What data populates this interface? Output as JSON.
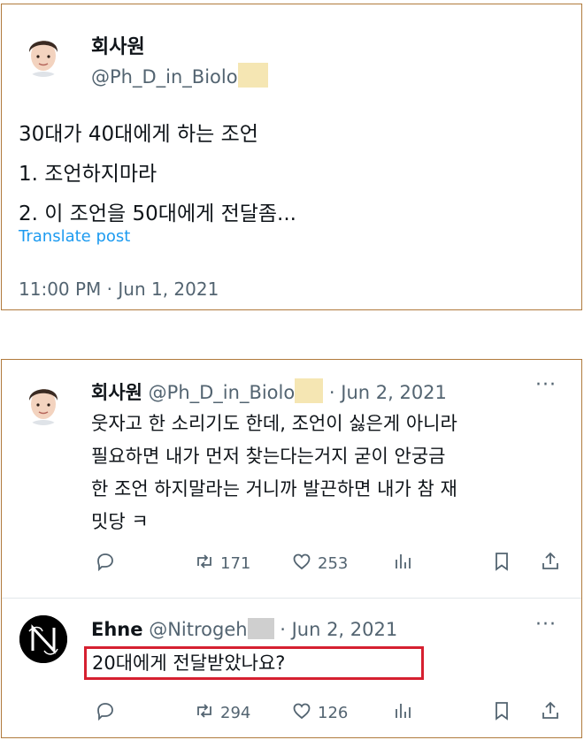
{
  "post": {
    "author_name": "회사원",
    "author_handle": "@Ph_D_in_Biolo",
    "lines": [
      "30대가 40대에게 하는 조언",
      "1. 조언하지마라",
      "2. 이 조언을 50대에게 전달좀..."
    ],
    "translate": "Translate post",
    "timestamp": "11:00 PM · Jun 1, 2021"
  },
  "reply1": {
    "author_name": "회사원",
    "author_handle": "@Ph_D_in_Biolo",
    "date": "· Jun 2, 2021",
    "more": "···",
    "lines": [
      "웃자고 한 소리기도 한데, 조언이 싫은게 아니라",
      "필요하면 내가 먼저 찾는다는거지 굳이 안궁금",
      "한 조언 하지말라는 거니까 발끈하면 내가 참 재",
      "밋당 ㅋ"
    ],
    "retweets": "171",
    "likes": "253"
  },
  "reply2": {
    "author_name": "Ehne",
    "author_handle": "@Nitrogeh",
    "date": "· Jun 2, 2021",
    "more": "···",
    "text": "20대에게 전달받았나요?",
    "retweets": "294",
    "likes": "126"
  },
  "icons": [
    "reply-icon",
    "retweet-icon",
    "like-icon",
    "views-icon",
    "bookmark-icon",
    "share-icon"
  ],
  "colors": {
    "accent_link": "#1d9bf0",
    "highlight_box": "#d62030",
    "frame": "#b07a3c"
  }
}
